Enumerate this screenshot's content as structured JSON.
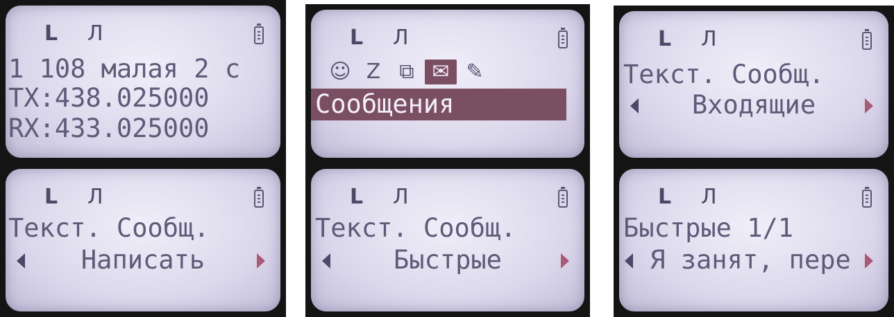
{
  "common": {
    "lock_glyph": "L",
    "signal_glyph": "Л"
  },
  "screen1": {
    "channel_line": "1 108 малая 2 с",
    "tx_line": "TX:438.025000",
    "rx_line": "RX:433.025000"
  },
  "screen2": {
    "icons": [
      "☺",
      "Z",
      "⧉",
      "✉",
      "✎"
    ],
    "selected_label": "Сообщения"
  },
  "screen3": {
    "title": "Текст. Сообщ.",
    "option": "Входящие"
  },
  "screen4": {
    "title": "Текст. Сообщ.",
    "option": "Написать"
  },
  "screen5": {
    "title": "Текст. Сообщ.",
    "option": "Быстрые"
  },
  "screen6": {
    "title": "Быстрые 1/1",
    "option": "Я занят, пере"
  },
  "colors": {
    "lcd_bg": "#e4e1f1",
    "text": "#5e5a78",
    "highlight": "#7b4f62",
    "arrow_right": "#a85b74"
  }
}
